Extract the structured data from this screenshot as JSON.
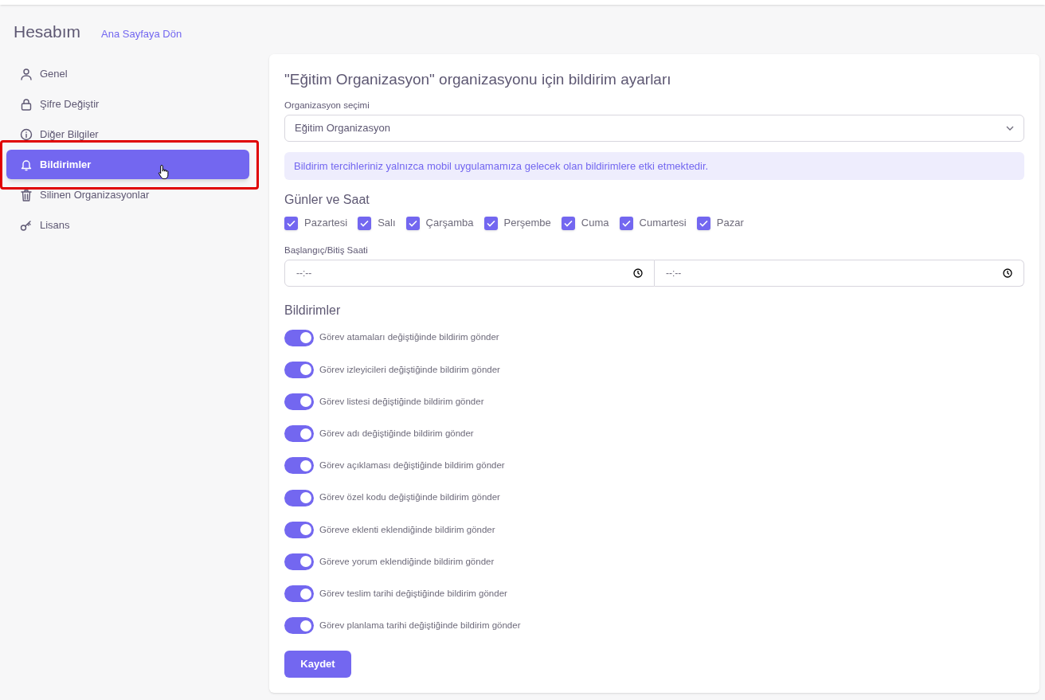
{
  "header": {
    "title": "Hesabım",
    "back_link": "Ana Sayfaya Dön"
  },
  "sidebar": {
    "items": [
      {
        "label": "Genel",
        "kind": "user",
        "selected": false
      },
      {
        "label": "Şifre Değiştir",
        "kind": "lock",
        "selected": false
      },
      {
        "label": "Diğer Bilgiler",
        "kind": "info",
        "selected": false
      },
      {
        "label": "Bildirimler",
        "kind": "bell",
        "selected": true
      },
      {
        "label": "Silinen Organizasyonlar",
        "kind": "trash",
        "selected": false
      },
      {
        "label": "Lisans",
        "kind": "key",
        "selected": false
      }
    ]
  },
  "card": {
    "title": "\"Eğitim Organizasyon\" organizasyonu için bildirim ayarları",
    "org_select": {
      "label": "Organizasyon seçimi",
      "value": "Eğitim Organizasyon"
    },
    "alert": "Bildirim tercihleriniz yalnızca mobil uygulamamıza gelecek olan bildirimlere etki etmektedir.",
    "days_heading": "Günler ve Saat",
    "days": [
      {
        "label": "Pazartesi",
        "checked": true
      },
      {
        "label": "Salı",
        "checked": true
      },
      {
        "label": "Çarşamba",
        "checked": true
      },
      {
        "label": "Perşembe",
        "checked": true
      },
      {
        "label": "Cuma",
        "checked": true
      },
      {
        "label": "Cumartesi",
        "checked": true
      },
      {
        "label": "Pazar",
        "checked": true
      }
    ],
    "time_label": "Başlangıç/Bitiş Saati",
    "time_fields": [
      {
        "value": "--:--"
      },
      {
        "value": "--:--"
      }
    ],
    "notifications_heading": "Bildirimler",
    "notifications": [
      {
        "label": "Görev atamaları değiştiğinde bildirim gönder",
        "on": true
      },
      {
        "label": "Görev izleyicileri değiştiğinde bildirim gönder",
        "on": true
      },
      {
        "label": "Görev listesi değiştiğinde bildirim gönder",
        "on": true
      },
      {
        "label": "Görev adı değiştiğinde bildirim gönder",
        "on": true
      },
      {
        "label": "Görev açıklaması değiştiğinde bildirim gönder",
        "on": true
      },
      {
        "label": "Görev özel kodu değiştiğinde bildirim gönder",
        "on": true
      },
      {
        "label": "Göreve eklenti eklendiğinde bildirim gönder",
        "on": true
      },
      {
        "label": "Göreve yorum eklendiğinde bildirim gönder",
        "on": true
      },
      {
        "label": "Görev teslim tarihi değiştiğinde bildirim gönder",
        "on": true
      },
      {
        "label": "Görev planlama tarihi değiştiğinde bildirim gönder",
        "on": true
      }
    ],
    "save_button": "Kaydet"
  }
}
